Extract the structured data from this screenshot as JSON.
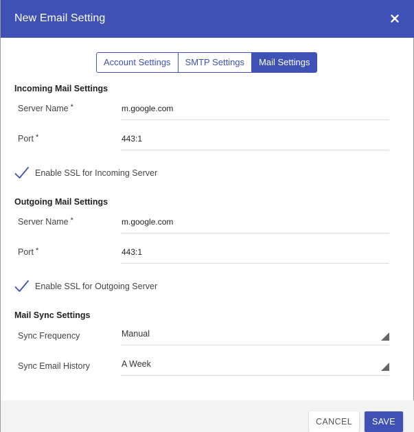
{
  "dialog": {
    "title": "New Email Setting",
    "close_icon": "close-icon",
    "colors": {
      "primary": "#3f51b5",
      "footer": "#f3f3f3",
      "divider": "#dcdcdc"
    }
  },
  "tabs": [
    {
      "label": "Account Settings",
      "active": false
    },
    {
      "label": "SMTP Settings",
      "active": false
    },
    {
      "label": "Mail Settings",
      "active": true
    }
  ],
  "incoming": {
    "section_title": "Incoming Mail Settings",
    "server_name": {
      "label": "Server Name",
      "required": "*",
      "value": "m.google.com"
    },
    "port": {
      "label": "Port",
      "required": "*",
      "value": "443:1"
    },
    "ssl": {
      "label": "Enable SSL for Incoming Server",
      "checked": true,
      "icon": "checkmark-icon"
    }
  },
  "outgoing": {
    "section_title": "Outgoing Mail Settings",
    "server_name": {
      "label": "Server Name",
      "required": "*",
      "value": "m.google.com"
    },
    "port": {
      "label": "Port",
      "required": "*",
      "value": "443:1"
    },
    "ssl": {
      "label": "Enable SSL for Outgoing Server",
      "checked": true,
      "icon": "checkmark-icon"
    }
  },
  "sync": {
    "section_title": "Mail Sync Settings",
    "frequency": {
      "label": "Sync Frequency",
      "value": "Manual",
      "icon": "dropdown-caret-icon"
    },
    "history": {
      "label": "Sync Email History",
      "value": "A Week",
      "icon": "dropdown-caret-icon"
    }
  },
  "footer": {
    "cancel_label": "CANCEL",
    "save_label": "SAVE"
  }
}
